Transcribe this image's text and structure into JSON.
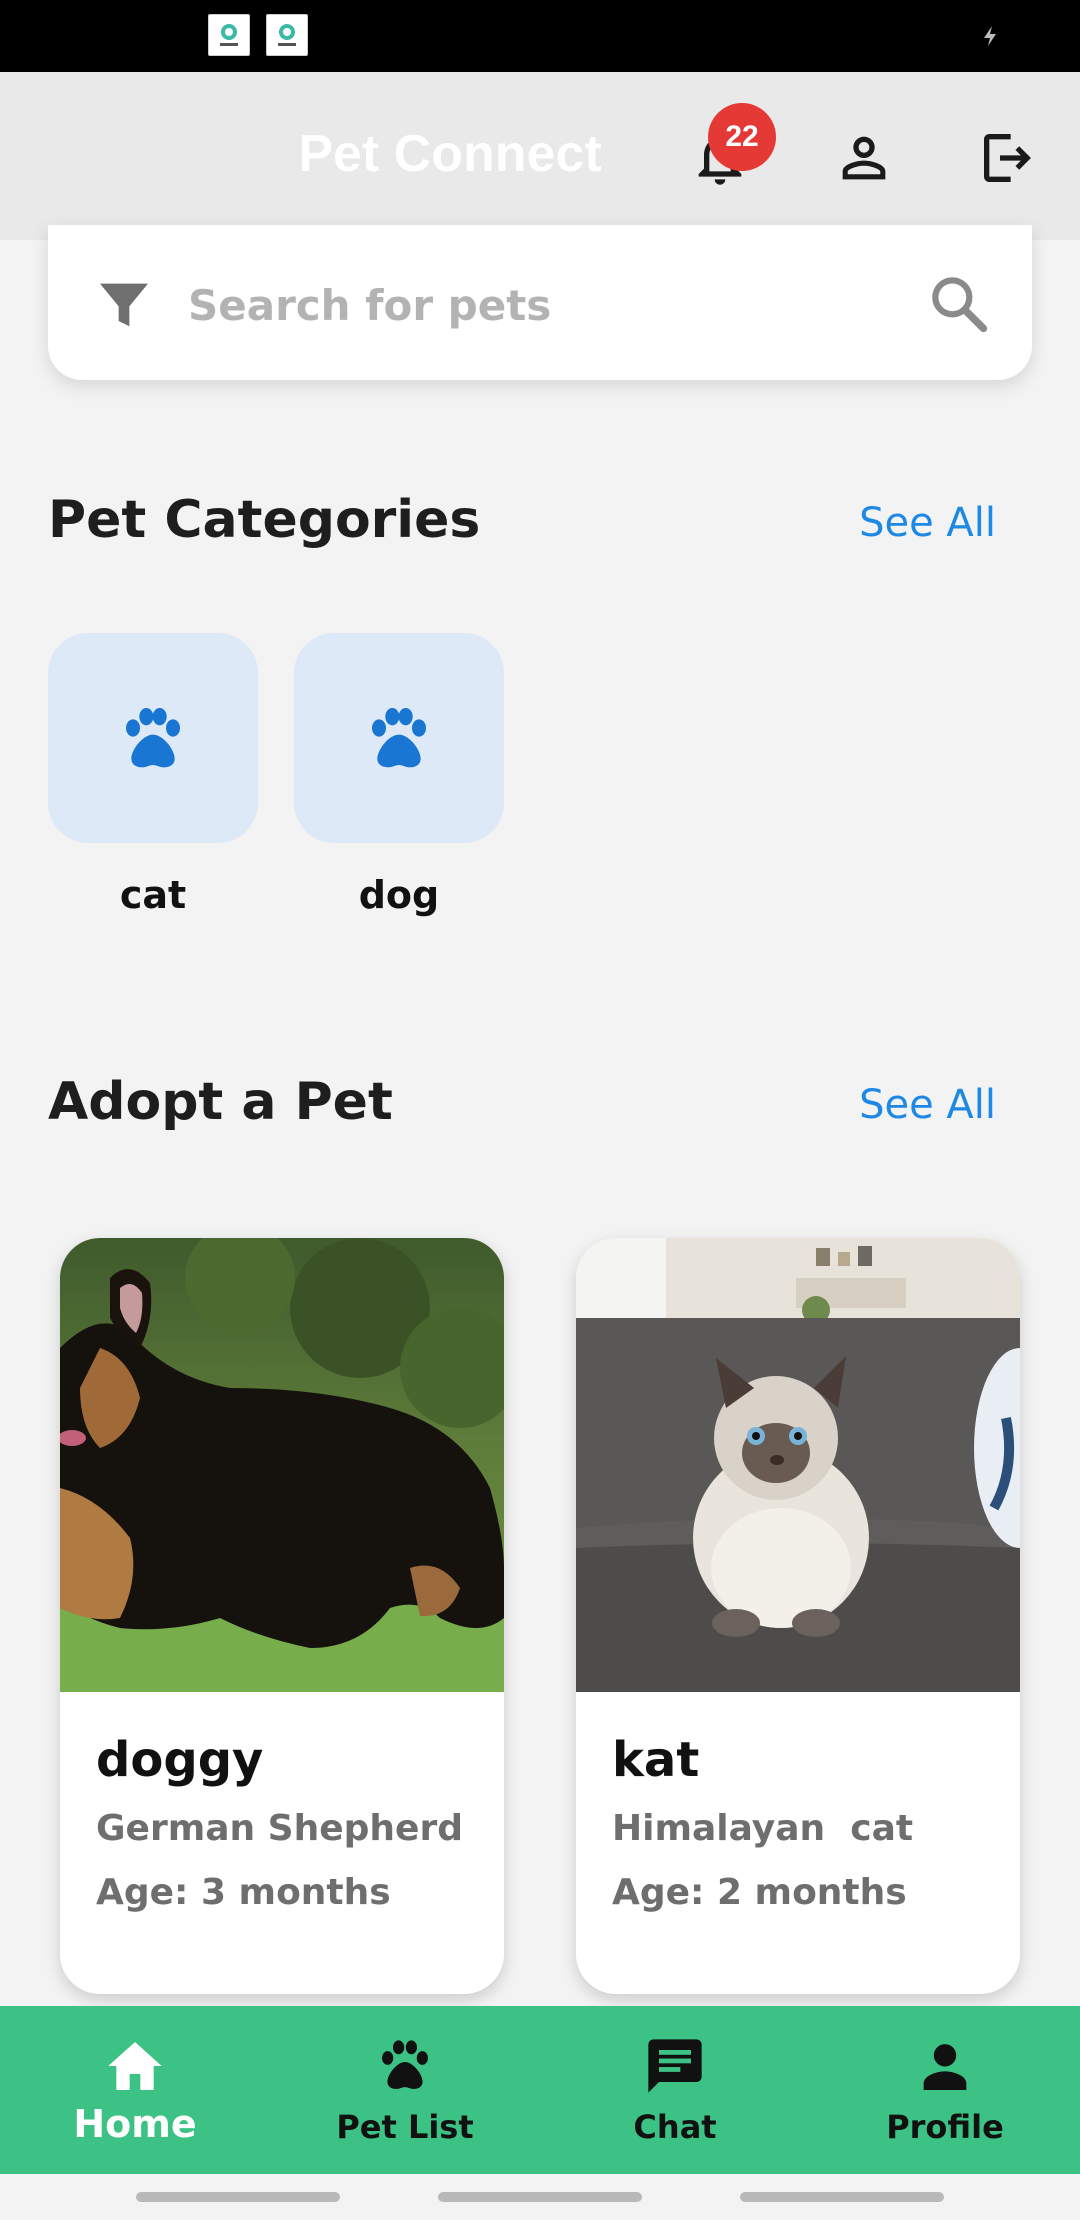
{
  "app": {
    "title": "Pet Connect",
    "notification_count": "22"
  },
  "search": {
    "placeholder": "Search for pets"
  },
  "categories_section": {
    "title": "Pet Categories",
    "see_all": "See All",
    "items": [
      {
        "label": "cat",
        "icon": "paw-icon"
      },
      {
        "label": "dog",
        "icon": "paw-icon"
      }
    ]
  },
  "adopt_section": {
    "title": "Adopt a Pet",
    "see_all": "See All",
    "pets": [
      {
        "name": "doggy",
        "breed": "German Shepherd",
        "age": "Age: 3 months"
      },
      {
        "name": "kat",
        "breed": "Himalayan  cat",
        "age": "Age: 2 months"
      }
    ]
  },
  "bottom_nav": {
    "items": [
      {
        "label": "Home",
        "icon": "home-icon",
        "active": true
      },
      {
        "label": "Pet List",
        "icon": "paw-icon",
        "active": false
      },
      {
        "label": "Chat",
        "icon": "chat-icon",
        "active": false
      },
      {
        "label": "Profile",
        "icon": "person-icon",
        "active": false
      }
    ]
  },
  "colors": {
    "accent_blue": "#1e88e5",
    "nav_green": "#3bc284",
    "badge_red": "#e53935",
    "category_tile": "#dde9f6",
    "paw_blue": "#1976d2"
  }
}
